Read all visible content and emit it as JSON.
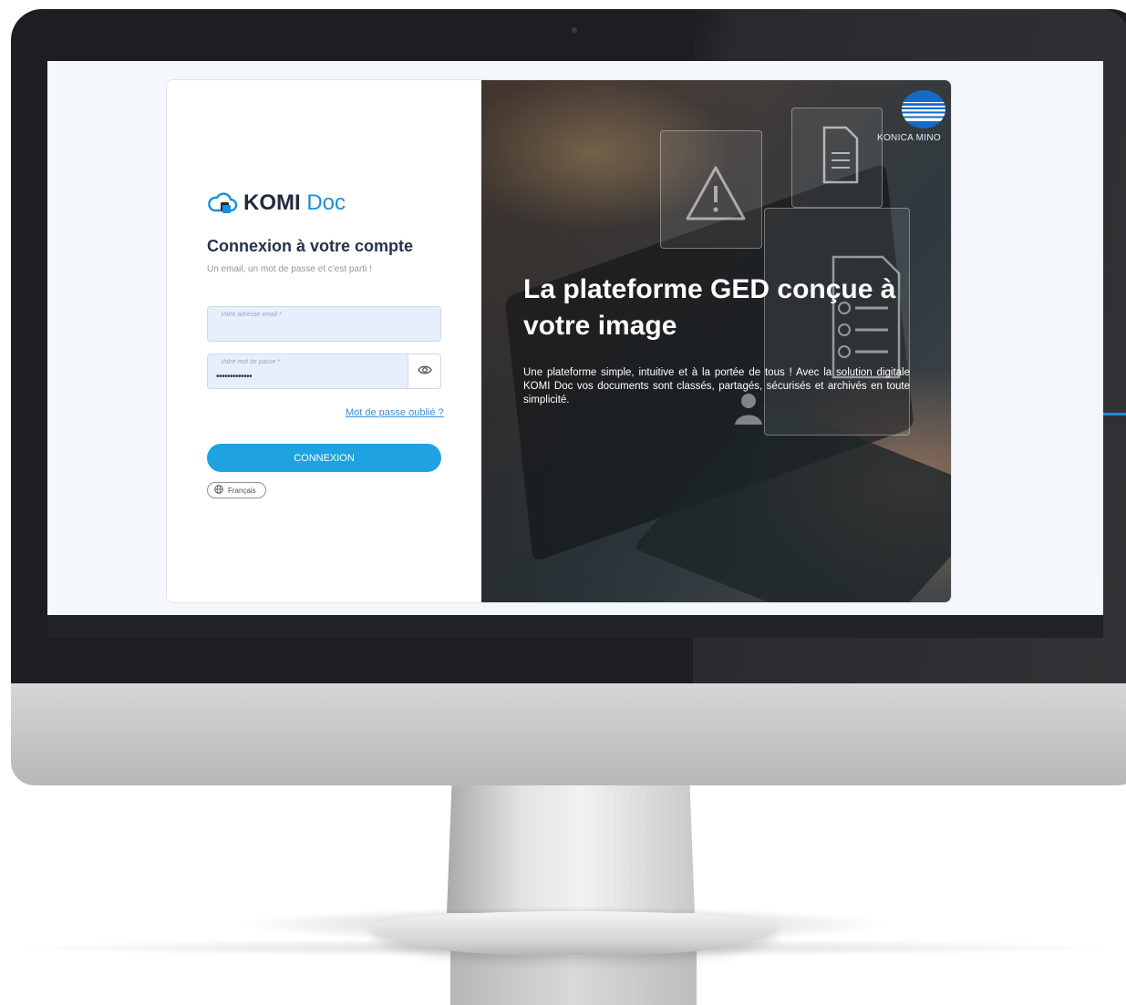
{
  "login": {
    "brand_komi": "KOMI",
    "brand_doc": "Doc",
    "title": "Connexion à votre compte",
    "subtitle": "Un email, un mot de passe et c'est parti !",
    "email_label": "Votre adresse email *",
    "email_value": "",
    "password_label": "Votre mot de passe *",
    "password_value": "•••••••••••••",
    "forgot_label": "Mot de passe oublié ?",
    "submit_label": "CONNEXION",
    "language_label": "Français"
  },
  "hero": {
    "brand_name": "KONICA MINO",
    "title": "La plateforme GED conçue à votre image",
    "description": "Une plateforme simple, intuitive et à la portée de tous ! Avec la solution digitale KOMI Doc vos documents sont classés, partagés, sécurisés et archivés en toute simplicité."
  },
  "colors": {
    "primary": "#1ea3e0",
    "link": "#3a8fd8",
    "title": "#24334a",
    "input_bg": "#e8effc"
  },
  "icons": [
    "cloud-logo-icon",
    "eye-icon",
    "globe-icon",
    "konica-minolta-globe-icon",
    "warning-icon",
    "file-icon",
    "checklist-icon",
    "user-icon"
  ]
}
